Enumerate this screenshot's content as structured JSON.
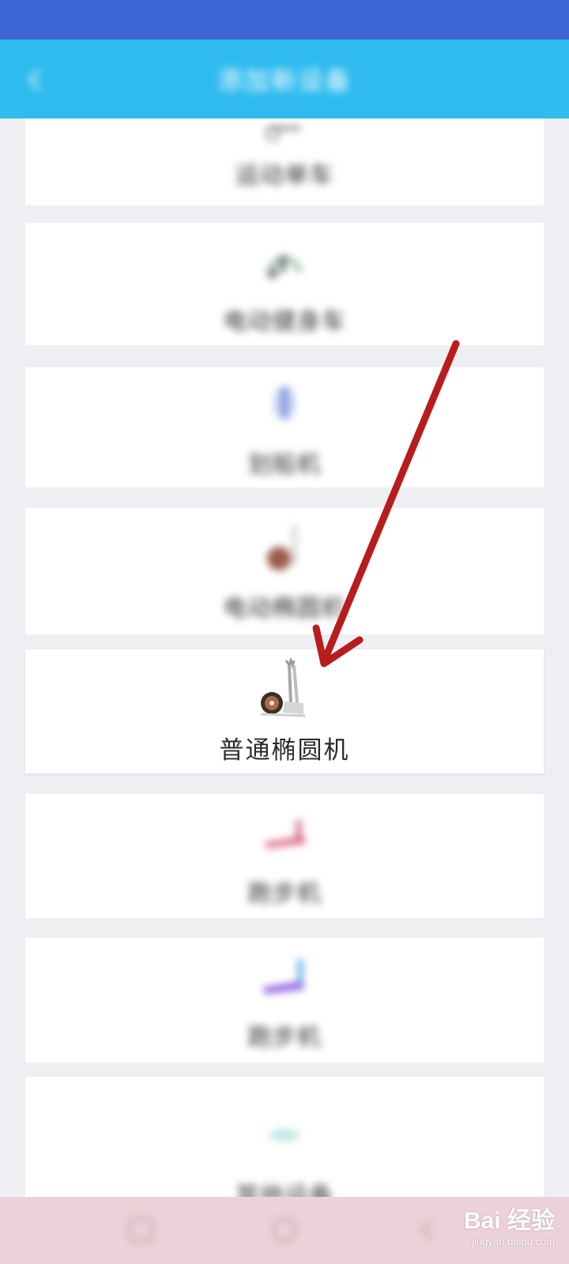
{
  "header": {
    "title": "添加新设备"
  },
  "devices": [
    {
      "label": "运动单车",
      "icon": "spin-bike-icon"
    },
    {
      "label": "电动健身车",
      "icon": "exercise-bike-icon"
    },
    {
      "label": "划船机",
      "icon": "rowing-machine-icon"
    },
    {
      "label": "电动椭圆机",
      "icon": "electric-elliptical-icon"
    },
    {
      "label": "普通椭圆机",
      "icon": "elliptical-trainer-icon",
      "highlighted": true
    },
    {
      "label": "跑步机",
      "icon": "treadmill-icon"
    },
    {
      "label": "跑步机",
      "icon": "treadmill-icon"
    },
    {
      "label": "其他设备",
      "icon": "other-device-icon"
    }
  ],
  "annotation": {
    "arrow_color": "#b91c1c"
  },
  "watermark": {
    "logo": "Bai 经验",
    "url": "jingyan.baidu.com"
  }
}
